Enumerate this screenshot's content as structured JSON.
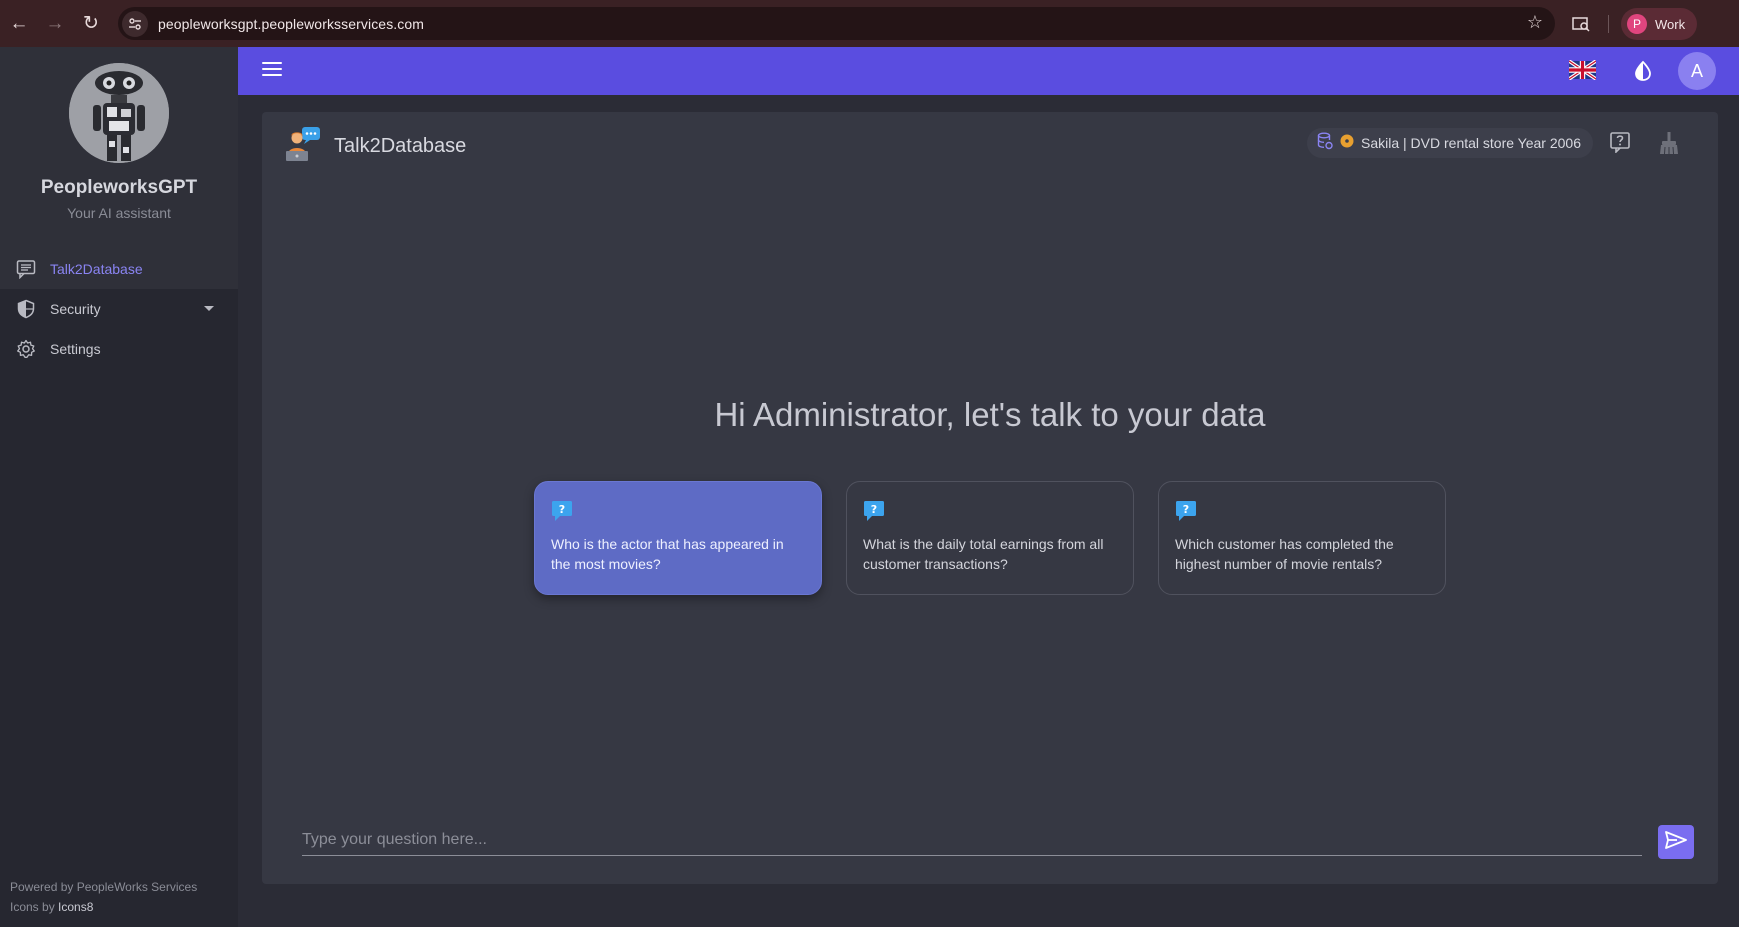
{
  "browser": {
    "url": "peopleworksgpt.peopleworksservices.com",
    "profile_initial": "P",
    "profile_name": "Work"
  },
  "sidebar": {
    "app_name": "PeopleworksGPT",
    "app_subtitle": "Your AI assistant",
    "items": [
      {
        "label": "Talk2Database",
        "icon": "chat-icon",
        "active": true
      },
      {
        "label": "Security",
        "icon": "shield-icon",
        "expandable": true
      },
      {
        "label": "Settings",
        "icon": "gear-icon"
      }
    ],
    "footer_powered": "Powered by PeopleWorks Services",
    "footer_icons_prefix": "Icons by ",
    "footer_icons_link": "Icons8"
  },
  "topbar": {
    "avatar_initial": "A",
    "language_icon": "uk-flag-icon",
    "theme_icon": "contrast-icon"
  },
  "main": {
    "title": "Talk2Database",
    "database_label": "Sakila | DVD rental store Year 2006",
    "greeting": "Hi Administrator, let's talk to your data",
    "suggestions": [
      {
        "text": "Who is the actor that has appeared in the most movies?",
        "highlighted": true
      },
      {
        "text": "What is the daily total earnings from all customer transactions?"
      },
      {
        "text": "Which customer has completed the highest number of movie rentals?"
      }
    ],
    "input_placeholder": "Type your question here..."
  },
  "colors": {
    "accent": "#5a4de0",
    "highlight_card": "#5e6bc5",
    "active_nav": "#8a84f2"
  }
}
